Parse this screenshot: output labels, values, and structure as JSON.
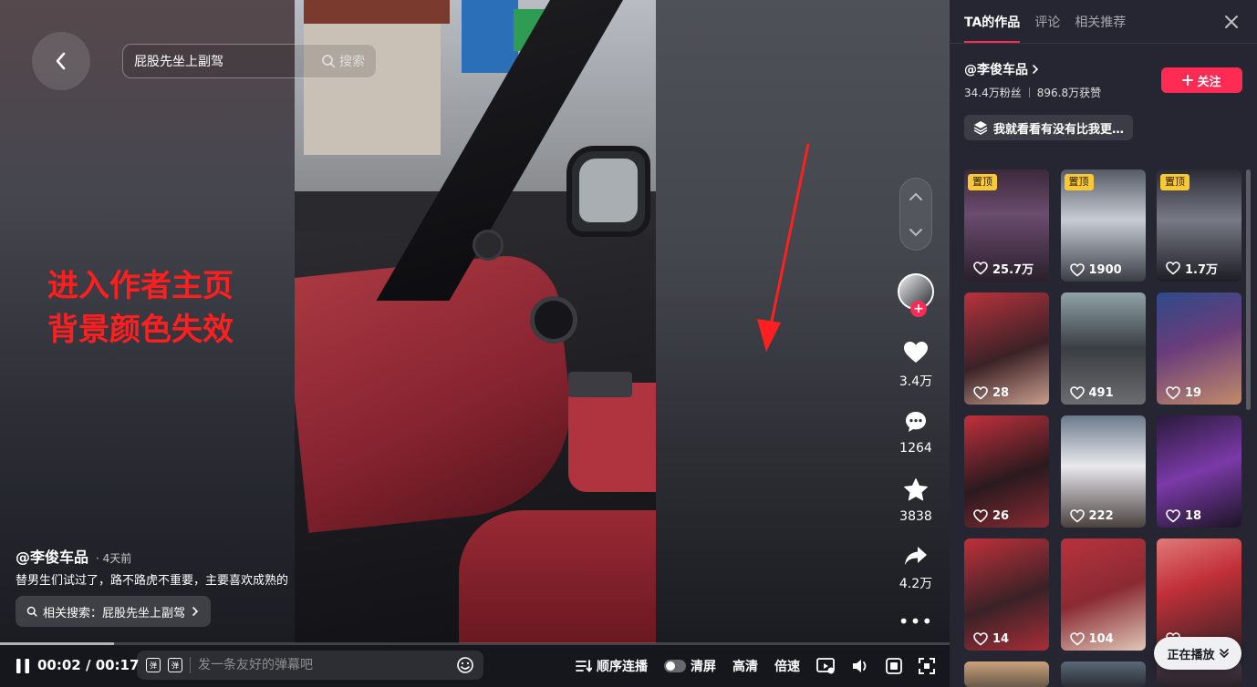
{
  "search": {
    "value": "屁股先坐上副驾",
    "button_label": "搜索"
  },
  "annotation": {
    "text": "进入作者主页\n背景颜色失效",
    "color": "#ff1f1f"
  },
  "video": {
    "author": "@李俊车品",
    "time_ago": "· 4天前",
    "description": "替男生们试过了，路不路虎不重要，主要喜欢成熟的",
    "related_search": "相关搜索：屁股先坐上副驾"
  },
  "actions": {
    "likes": "3.4万",
    "comments": "1264",
    "favorites": "3838",
    "shares": "4.2万"
  },
  "player": {
    "current_time": "00:02",
    "total_time": "00:17",
    "progress": 0.12,
    "danmaku_placeholder": "发一条友好的弹幕吧",
    "autoplay_label": "顺序连播",
    "clear_screen_label": "清屏",
    "quality_label": "高清",
    "speed_label": "倍速"
  },
  "panel": {
    "tabs": [
      "TA的作品",
      "评论",
      "相关推荐"
    ],
    "author": "@李俊车品",
    "followers": "34.4万粉丝",
    "total_likes": "896.8万获赞",
    "follow_label": "关注",
    "collection": "我就看看有没有比我更…",
    "pin_label": "置顶",
    "videos": [
      {
        "likes": "25.7万",
        "pinned": true,
        "bg": "linear-gradient(180deg,#3b2a3a 0%,#6b4c6e 40%,#2a1f2c 100%)"
      },
      {
        "likes": "1900",
        "pinned": true,
        "bg": "linear-gradient(180deg,#555a66 0%,#c8ccd4 45%,#3a3d45 100%)"
      },
      {
        "likes": "1.7万",
        "pinned": true,
        "bg": "linear-gradient(180deg,#2b2b36 0%,#777a86 45%,#1d1d24 100%)"
      },
      {
        "likes": "28",
        "pinned": false,
        "bg": "linear-gradient(160deg,#b8323d 0%,#3b2226 55%,#c99e8d 100%)"
      },
      {
        "likes": "491",
        "pinned": false,
        "bg": "linear-gradient(180deg,#8fa3a8 0%,#3a3d42 50%,#6b6d70 100%)"
      },
      {
        "likes": "19",
        "pinned": false,
        "bg": "linear-gradient(160deg,#2f4a8a 0%,#6a3d7a 45%,#c28b6a 100%)"
      },
      {
        "likes": "26",
        "pinned": false,
        "bg": "linear-gradient(160deg,#c2303c 0%,#2a1a1e 55%,#8a2a32 100%)"
      },
      {
        "likes": "222",
        "pinned": false,
        "bg": "linear-gradient(180deg,#6b7a8a 0%,#e9e9ee 45%,#4a4040 100%)"
      },
      {
        "likes": "18",
        "pinned": false,
        "bg": "linear-gradient(160deg,#2a1a3a 0%,#7a3aa8 50%,#1c1424 100%)"
      },
      {
        "likes": "14",
        "pinned": false,
        "bg": "linear-gradient(160deg,#c0303a 0%,#3a2226 55%,#a82d38 100%)"
      },
      {
        "likes": "104",
        "pinned": false,
        "bg": "linear-gradient(160deg,#b8323d 0%,#8a2a32 50%,#e0c8b8 100%)"
      },
      {
        "likes": "",
        "pinned": false,
        "bg": "linear-gradient(160deg,#e07a7a 0%,#c23038 40%,#3a2226 100%)"
      }
    ],
    "partial_row": [
      {
        "bg": "linear-gradient(180deg,#c9a27a 0%,#6a5a4a 100%)"
      },
      {
        "bg": "linear-gradient(180deg,#5a6a7a 0%,#2a2d33 100%)"
      },
      {
        "bg": "linear-gradient(180deg,#4a3a4a 0%,#2a2226 100%)"
      }
    ],
    "now_playing_label": "正在播放"
  },
  "colors": {
    "accent": "#fe2c55",
    "panel_bg": "#252632",
    "pin_bg": "#f8c935"
  }
}
